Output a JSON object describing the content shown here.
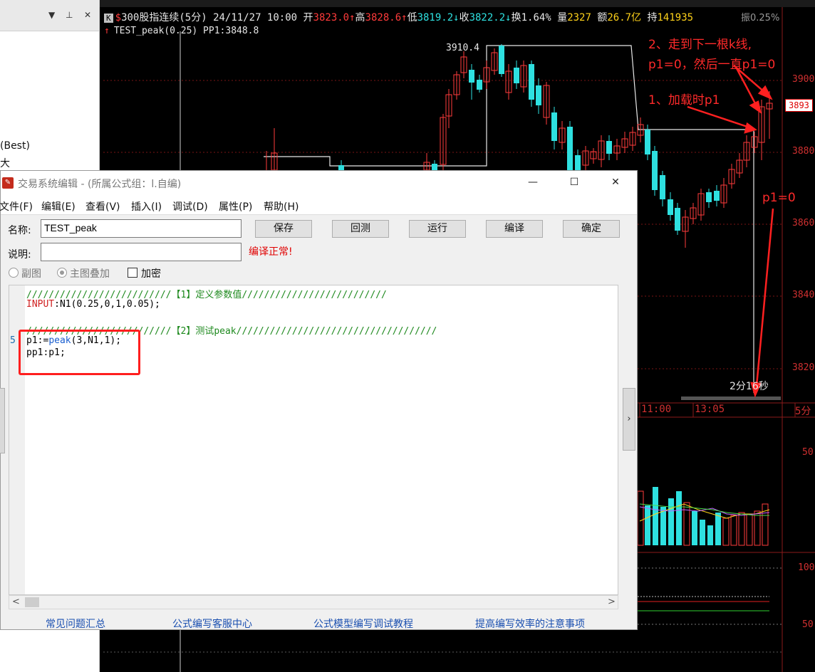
{
  "left_panel": {
    "best_label": "(Best)",
    "da_label": "大"
  },
  "quote": {
    "k_badge": "K",
    "dollar": "$",
    "name_period": "300股指连续(5分)",
    "datetime": "24/11/27 10:00",
    "open_label": "开",
    "open_value": "3823.0",
    "high_label": "高",
    "high_value": "3828.6",
    "low_label": "低",
    "low_value": "3819.2",
    "close_label": "收",
    "close_value": "3822.2",
    "turnover_label": "换",
    "turnover_value": "1.64%",
    "volume_label": "量",
    "volume_value": "2327",
    "amount_label": "额",
    "amount_value": "26.7亿",
    "hold_label": "持",
    "hold_value": "141935",
    "extra": "振0.25%"
  },
  "indicator": {
    "text": "TEST_peak(0.25) PP1:3848.8"
  },
  "chart": {
    "peak_label": "3910.4",
    "price_labels": [
      "3900",
      "3880",
      "3860",
      "3840",
      "3820"
    ],
    "price_tag": "3893",
    "time_labels": [
      "11:00",
      "13:05",
      "5分"
    ],
    "countdown": "2分16秒",
    "sub_labels": [
      "50",
      "100",
      "50"
    ]
  },
  "annotations": {
    "note2_line1": "2、走到下一根k线,",
    "note2_line2": "p1=0，然后一直p1=0",
    "note1": "1、加载时p1",
    "note3": "p1=0"
  },
  "dialog": {
    "title": "交易系统编辑 - (所属公式组：l.自编)",
    "menu": [
      "文件(F)",
      "编辑(E)",
      "查看(V)",
      "插入(I)",
      "调试(D)",
      "属性(P)",
      "帮助(H)"
    ],
    "name_label": "名称:",
    "name_value": "TEST_peak",
    "desc_label": "说明:",
    "desc_value": "",
    "buttons": {
      "save": "保存",
      "backtest": "回测",
      "run": "运行",
      "compile": "编译",
      "ok": "确定"
    },
    "compile_status": "编译正常!",
    "options": {
      "sub_chart": "副图",
      "main_overlay": "主图叠加",
      "encrypt": "加密"
    },
    "code": {
      "line1": "//////////////////////////【1】定义参数值//////////////////////////",
      "line2_kw": "INPUT",
      "line2_rest": ":N1(0.25,0,1,0.05);",
      "line4": "//////////////////////////【2】测试peak////////////////////////////////////",
      "line5_a": "p1:=",
      "line5_fn": "peak",
      "line5_b": "(3,N1,1);",
      "line6": "pp1:p1;",
      "line_number": "5"
    },
    "footer_links": [
      "常见问题汇总",
      "公式编写客服中心",
      "公式模型编写调试教程",
      "提高编写效率的注意事项"
    ]
  }
}
